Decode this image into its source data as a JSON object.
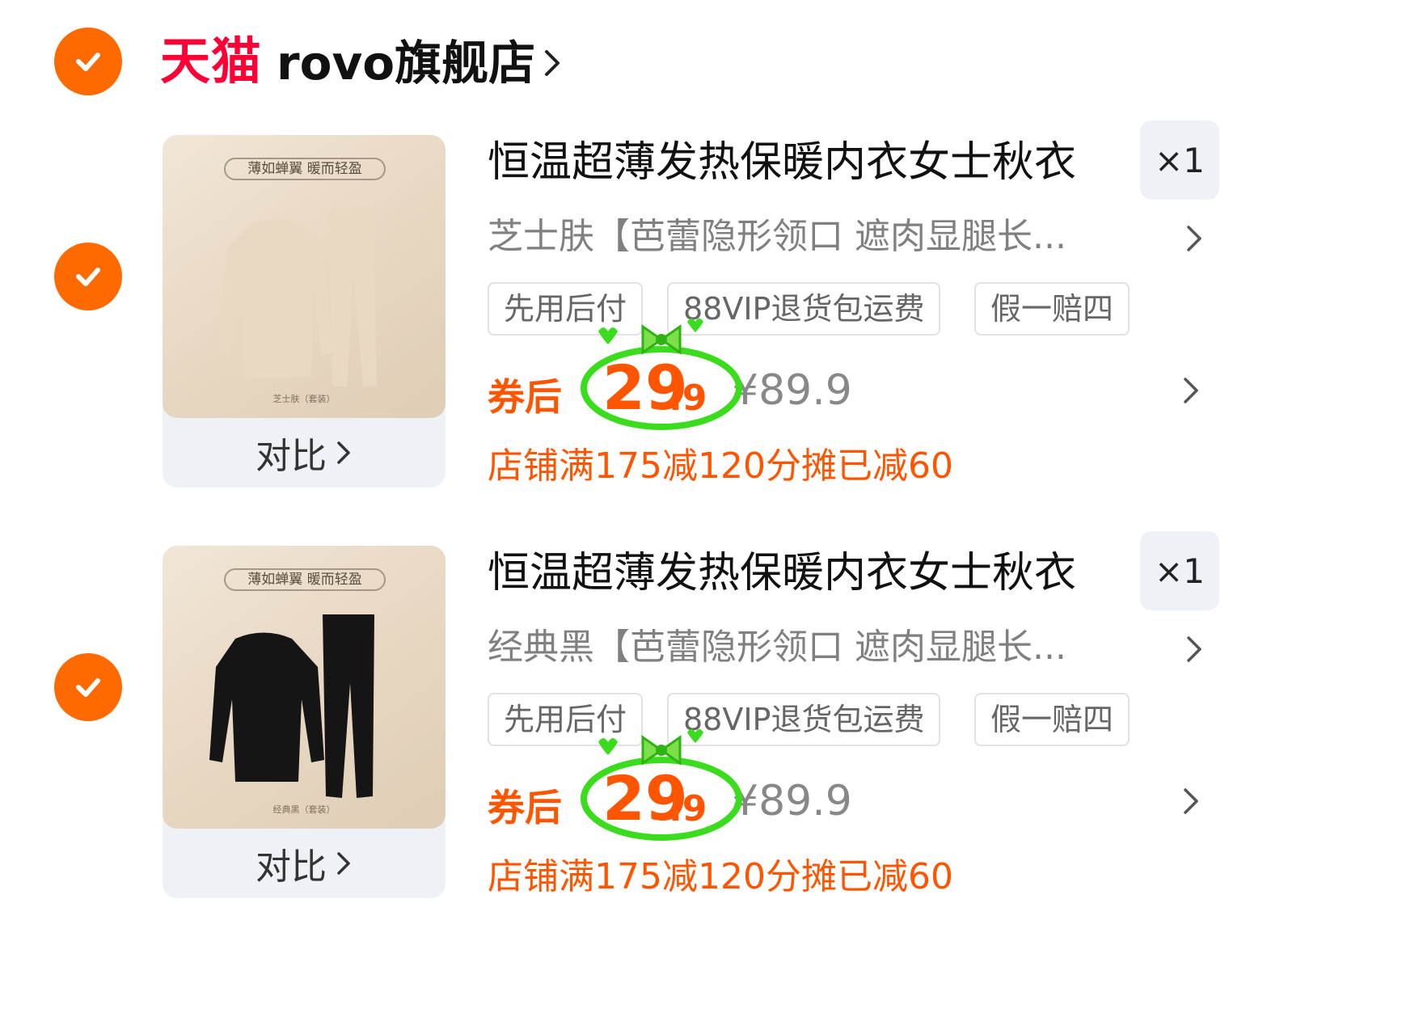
{
  "store": {
    "platform_label": "天猫",
    "name": "rovo旗舰店",
    "selected": true
  },
  "items": [
    {
      "selected": true,
      "thumb_banner": "薄如蝉翼  暖而轻盈",
      "thumb_caption": "芝士肤（套装）",
      "garment_color": "#e9d8c2",
      "compare_label": "对比",
      "title": "恒温超薄发热保暖内衣女士秋衣",
      "quantity": "×1",
      "spec": "芝士肤【芭蕾隐形领口 遮肉显腿长...",
      "tags": [
        "先用后付",
        "88VIP退货包运费",
        "假一赔四"
      ],
      "coupon_label": "券后",
      "price_int": "29",
      "price_dec": ".9",
      "original_price": "¥89.9",
      "promo": "店铺满175减120分摊已减60"
    },
    {
      "selected": true,
      "thumb_banner": "薄如蝉翼  暖而轻盈",
      "thumb_caption": "经典黑（套装）",
      "garment_color": "#151515",
      "compare_label": "对比",
      "title": "恒温超薄发热保暖内衣女士秋衣",
      "quantity": "×1",
      "spec": "经典黑【芭蕾隐形领口 遮肉显腿长...",
      "tags": [
        "先用后付",
        "88VIP退货包运费",
        "假一赔四"
      ],
      "coupon_label": "券后",
      "price_int": "29",
      "price_dec": ".9",
      "original_price": "¥89.9",
      "promo": "店铺满175减120分摊已减60"
    }
  ],
  "colors": {
    "accent": "#ff6a00",
    "price": "#ff5500",
    "tmall_red": "#ff0036",
    "doodle_green": "#3bdc1e"
  },
  "icons": [
    "check-icon",
    "chevron-right-icon",
    "bow-doodle-icon"
  ]
}
